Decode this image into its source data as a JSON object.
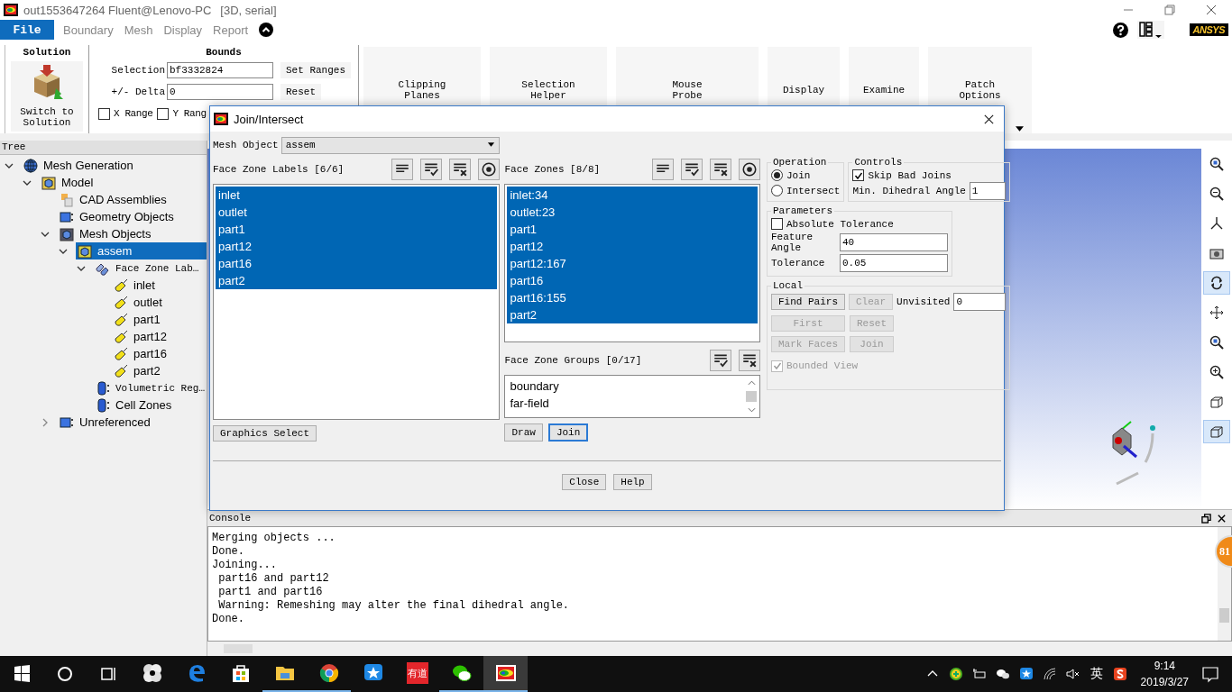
{
  "window": {
    "title": "out1553647264 Fluent@Lenovo-PC",
    "mode": "[3D, serial]"
  },
  "logo": "ANSYS",
  "menu": [
    {
      "label": "File",
      "selected": true
    },
    {
      "label": "Boundary",
      "selected": false
    },
    {
      "label": "Mesh",
      "selected": false
    },
    {
      "label": "Display",
      "selected": false
    },
    {
      "label": "Report",
      "selected": false
    }
  ],
  "ribbon": {
    "solution": {
      "title": "Solution",
      "button": "Switch to Solution"
    },
    "bounds": {
      "title": "Bounds",
      "selection_label": "Selection",
      "selection_value": "bf3332824",
      "set_ranges": "Set Ranges",
      "delta_label": "+/- Delta",
      "delta_value": "0",
      "reset": "Reset",
      "ranges": [
        {
          "label": "X Range",
          "checked": false
        },
        {
          "label": "Y Rang",
          "checked": false
        }
      ]
    },
    "tools": [
      {
        "label": "Clipping Planes"
      },
      {
        "label": "Selection Helper"
      },
      {
        "label": "Mouse Probe"
      },
      {
        "label": "Display"
      },
      {
        "label": "Examine"
      },
      {
        "label": "Patch Options"
      }
    ]
  },
  "tree": {
    "title": "Tree",
    "items": [
      {
        "label": "Mesh Generation",
        "kind": "root",
        "expanded": true,
        "selected": false,
        "children": [
          {
            "label": "Model",
            "kind": "model",
            "expanded": true,
            "selected": false,
            "children": [
              {
                "label": "CAD Assemblies",
                "kind": "assemblies",
                "selected": false
              },
              {
                "label": "Geometry Objects",
                "kind": "geometry",
                "selected": false
              },
              {
                "label": "Mesh Objects",
                "kind": "mesh",
                "expanded": true,
                "selected": false,
                "children": [
                  {
                    "label": "assem",
                    "kind": "object",
                    "expanded": true,
                    "selected": true,
                    "children": [
                      {
                        "label": "Face Zone Lab…",
                        "kind": "labels",
                        "expanded": true,
                        "selected": false,
                        "children": [
                          {
                            "label": "inlet",
                            "kind": "label",
                            "selected": false
                          },
                          {
                            "label": "outlet",
                            "kind": "label",
                            "selected": false
                          },
                          {
                            "label": "part1",
                            "kind": "label",
                            "selected": false
                          },
                          {
                            "label": "part12",
                            "kind": "label",
                            "selected": false
                          },
                          {
                            "label": "part16",
                            "kind": "label",
                            "selected": false
                          },
                          {
                            "label": "part2",
                            "kind": "label",
                            "selected": false
                          }
                        ]
                      },
                      {
                        "label": "Volumetric Reg…",
                        "kind": "region",
                        "selected": false
                      },
                      {
                        "label": "Cell Zones",
                        "kind": "cells",
                        "selected": false
                      }
                    ]
                  }
                ]
              },
              {
                "label": "Unreferenced",
                "kind": "unreferenced",
                "expanded": false,
                "selected": false
              }
            ]
          }
        ]
      }
    ]
  },
  "viewport": {
    "tools": [
      {
        "kind": "zoom-fit",
        "selected": false
      },
      {
        "kind": "zoom-out",
        "selected": false
      },
      {
        "kind": "axes",
        "selected": false
      },
      {
        "kind": "camera",
        "selected": false
      },
      {
        "kind": "rotate",
        "selected": true
      },
      {
        "kind": "pan",
        "selected": false
      },
      {
        "kind": "zoom-region",
        "selected": false
      },
      {
        "kind": "zoom-in",
        "selected": false
      },
      {
        "kind": "cube",
        "selected": false
      },
      {
        "kind": "cube-outline",
        "selected": true
      }
    ]
  },
  "console": {
    "title": "Console",
    "lines": [
      "Merging objects ...",
      "Done.",
      "Joining...",
      " part16 and part12",
      " part1 and part16",
      " Warning: Remeshing may alter the final dihedral angle.",
      "Done."
    ]
  },
  "floating_badge": "81",
  "dialog": {
    "title": "Join/Intersect",
    "mesh_object": {
      "label": "Mesh Object",
      "value": "assem"
    },
    "face_zone_labels": {
      "title": "Face Zone Labels [6/6]",
      "items": [
        {
          "label": "inlet",
          "selected": true
        },
        {
          "label": "outlet",
          "selected": true
        },
        {
          "label": "part1",
          "selected": true
        },
        {
          "label": "part12",
          "selected": true
        },
        {
          "label": "part16",
          "selected": true
        },
        {
          "label": "part2",
          "selected": true
        }
      ],
      "button": "Graphics Select"
    },
    "face_zones": {
      "title": "Face Zones [8/8]",
      "items": [
        {
          "label": "inlet:34",
          "selected": true
        },
        {
          "label": "outlet:23",
          "selected": true
        },
        {
          "label": "part1",
          "selected": true
        },
        {
          "label": "part12",
          "selected": true
        },
        {
          "label": "part12:167",
          "selected": true
        },
        {
          "label": "part16",
          "selected": true
        },
        {
          "label": "part16:155",
          "selected": true
        },
        {
          "label": "part2",
          "selected": true
        }
      ]
    },
    "face_zone_groups": {
      "title": "Face Zone Groups [0/17]",
      "items": [
        {
          "label": "boundary",
          "selected": false
        },
        {
          "label": "far-field",
          "selected": false
        }
      ]
    },
    "zone_buttons": [
      {
        "label": "Draw",
        "focused": false
      },
      {
        "label": "Join",
        "focused": true
      }
    ],
    "operation": {
      "title": "Operation",
      "options": [
        {
          "label": "Join",
          "selected": true
        },
        {
          "label": "Intersect",
          "selected": false
        }
      ]
    },
    "controls": {
      "title": "Controls",
      "skip_bad_joins": {
        "label": "Skip Bad Joins",
        "checked": true
      },
      "min_dihedral_angle": {
        "label": "Min. Dihedral Angle",
        "value": "1"
      }
    },
    "parameters": {
      "title": "Parameters",
      "absolute_tolerance": {
        "label": "Absolute Tolerance",
        "checked": false
      },
      "feature_angle": {
        "label": "Feature Angle",
        "value": "40"
      },
      "tolerance": {
        "label": "Tolerance",
        "value": "0.05"
      }
    },
    "local": {
      "title": "Local",
      "find_pairs": {
        "label": "Find Pairs",
        "disabled": false
      },
      "clear": {
        "label": "Clear",
        "disabled": true
      },
      "unvisited": {
        "label": "Unvisited",
        "value": "0"
      },
      "buttons": [
        {
          "label": "First",
          "disabled": true
        },
        {
          "label": "Reset",
          "disabled": true
        },
        {
          "label": "Mark Faces",
          "disabled": true
        },
        {
          "label": "Join",
          "disabled": true
        }
      ],
      "bounded_view": {
        "label": "Bounded View",
        "checked": true,
        "disabled": true
      }
    },
    "footer": [
      "Close",
      "Help"
    ]
  },
  "taskbar": {
    "apps": [
      {
        "kind": "pinwheel",
        "running": false,
        "selected": false
      },
      {
        "kind": "edge",
        "running": false,
        "selected": false
      },
      {
        "kind": "store",
        "running": false,
        "selected": false
      },
      {
        "kind": "folder",
        "running": true,
        "selected": false
      },
      {
        "kind": "chrome",
        "running": true,
        "selected": false
      },
      {
        "kind": "star",
        "running": false,
        "selected": false
      },
      {
        "kind": "dictionary",
        "label": "有道",
        "running": false,
        "selected": false
      },
      {
        "kind": "chat",
        "running": true,
        "selected": false
      },
      {
        "kind": "fluent",
        "running": true,
        "selected": true
      }
    ],
    "input_language": "英",
    "time": "9:14",
    "date": "2019/3/27"
  }
}
